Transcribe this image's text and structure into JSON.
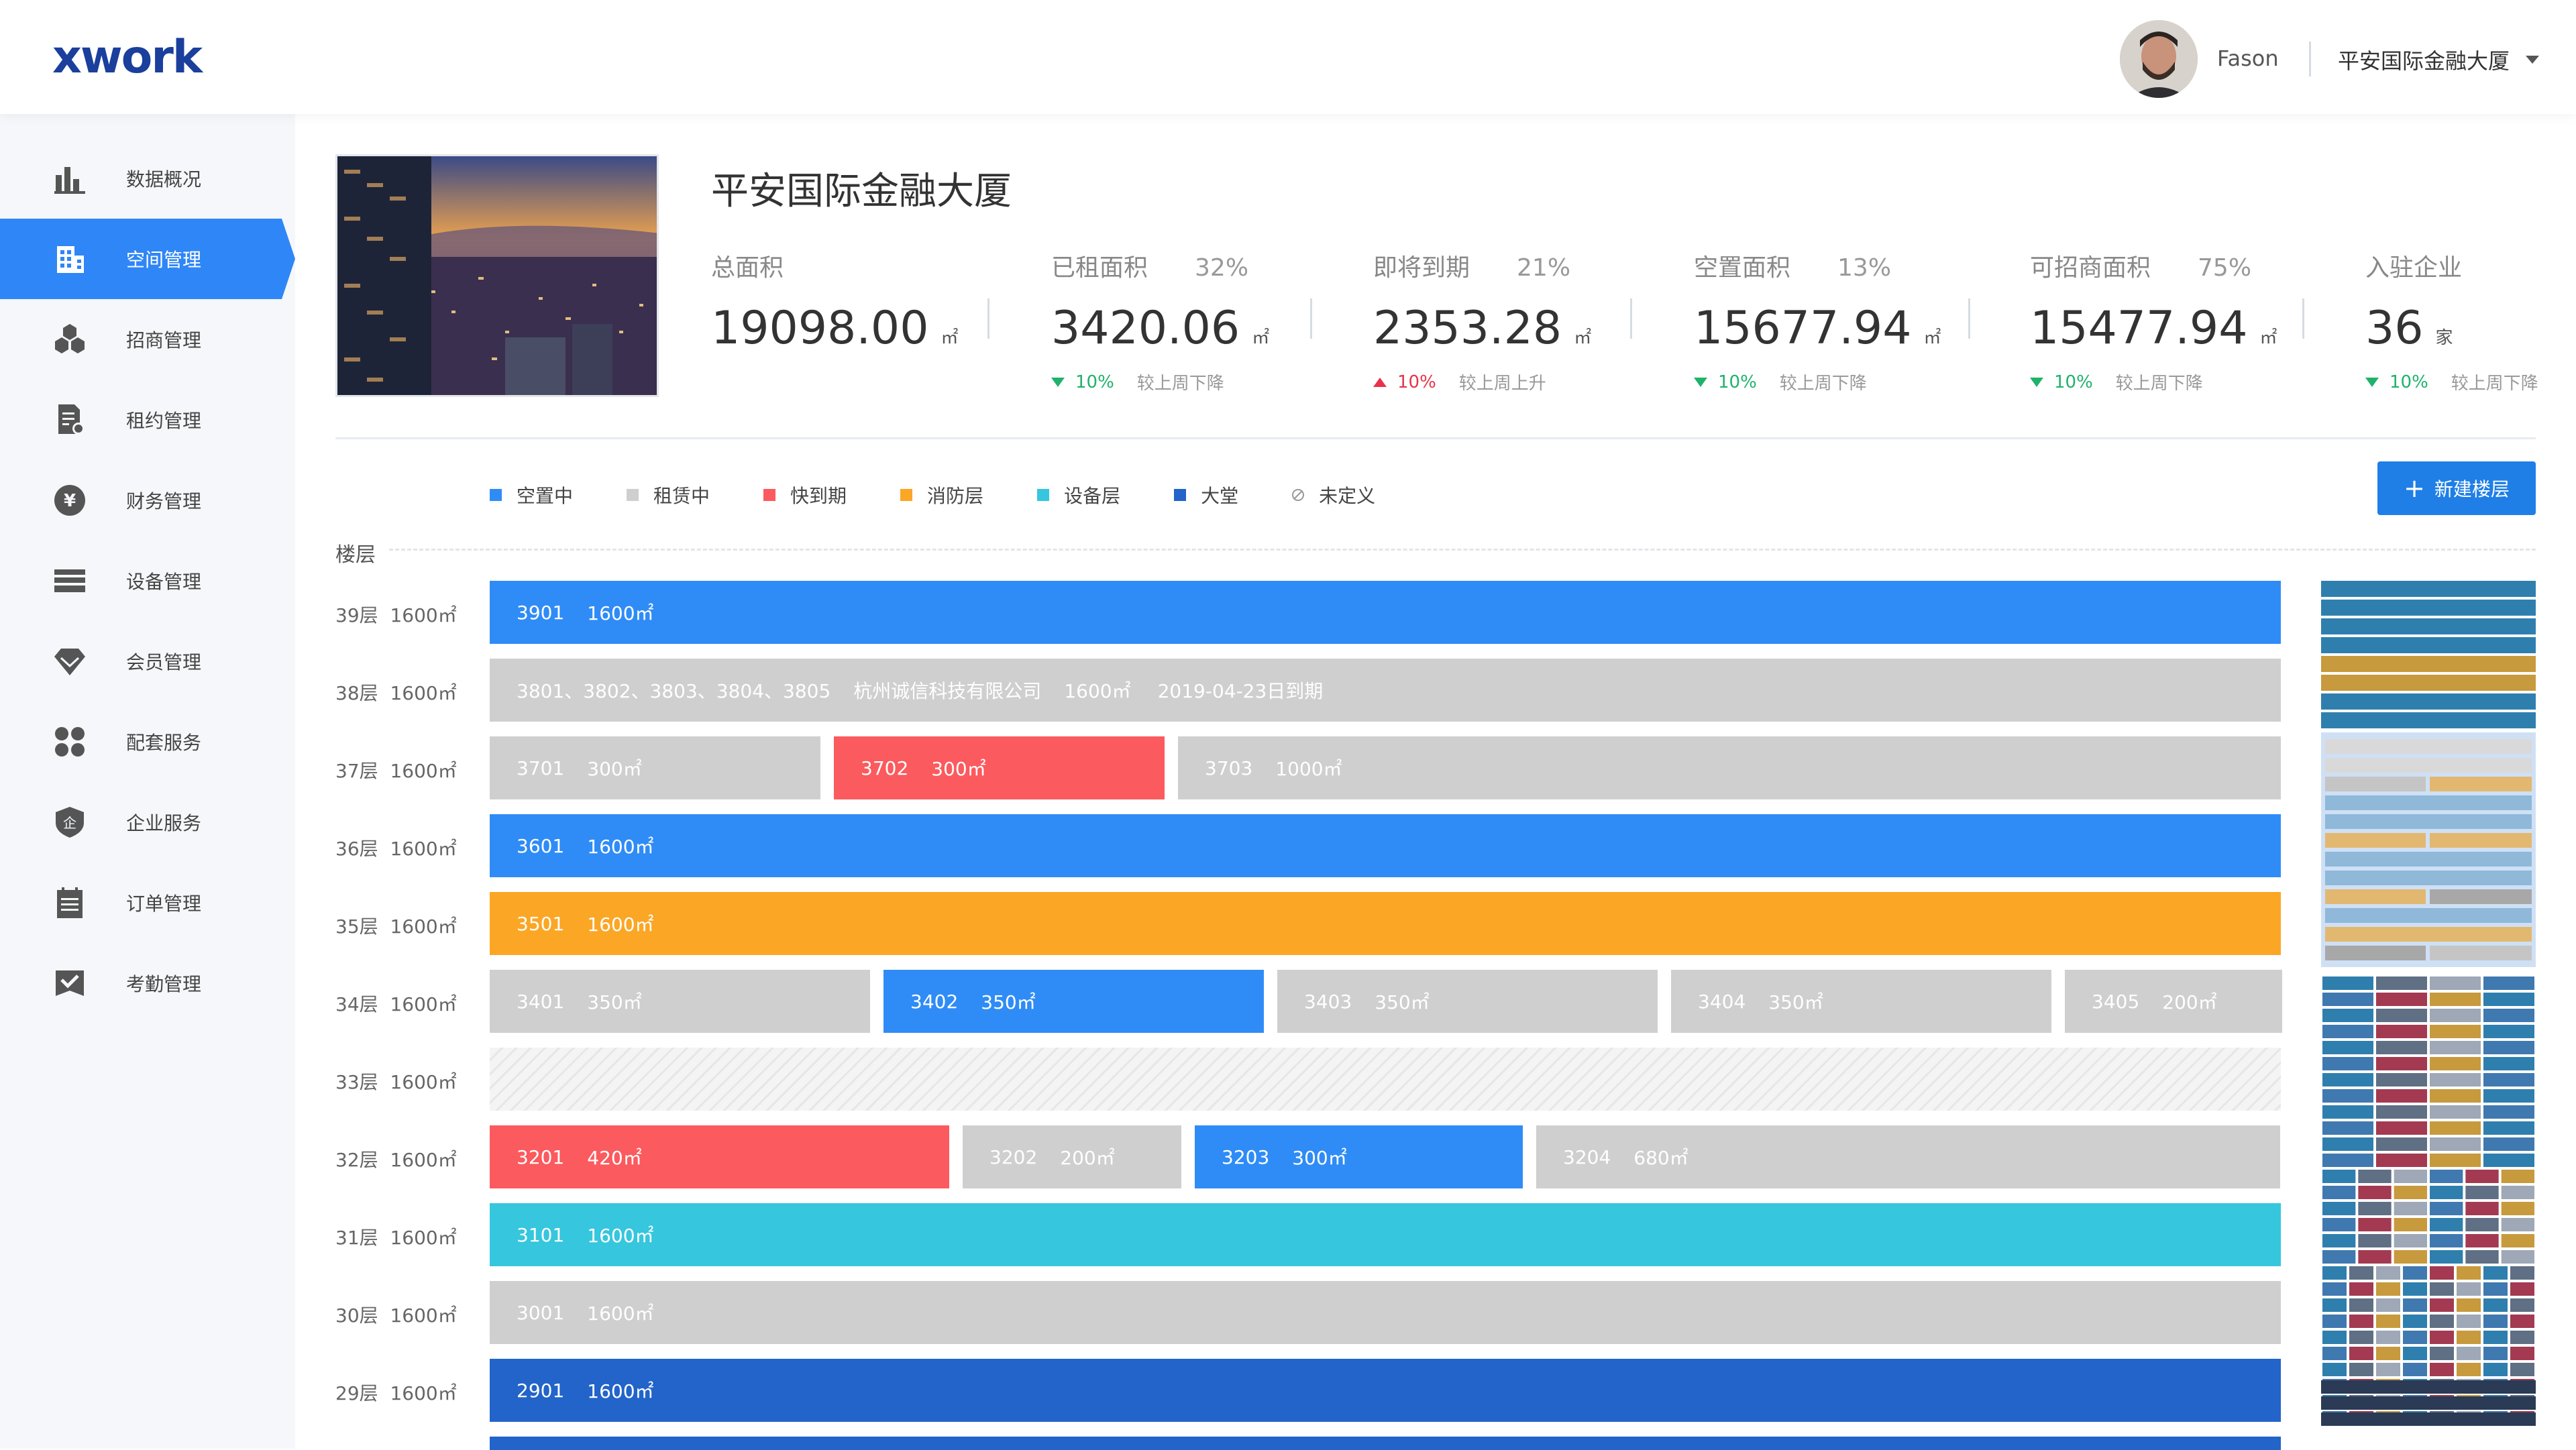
{
  "header": {
    "logo": "xwork",
    "user_name": "Fason",
    "building_select": "平安国际金融大厦"
  },
  "sidebar": {
    "items": [
      {
        "label": "数据概况",
        "icon": "bar-chart-icon",
        "active": false
      },
      {
        "label": "空间管理",
        "icon": "building-icon",
        "active": true
      },
      {
        "label": "招商管理",
        "icon": "hexagons-icon",
        "active": false
      },
      {
        "label": "租约管理",
        "icon": "contract-icon",
        "active": false
      },
      {
        "label": "财务管理",
        "icon": "yen-icon",
        "active": false
      },
      {
        "label": "设备管理",
        "icon": "device-icon",
        "active": false
      },
      {
        "label": "会员管理",
        "icon": "diamond-icon",
        "active": false
      },
      {
        "label": "配套服务",
        "icon": "grid-services-icon",
        "active": false
      },
      {
        "label": "企业服务",
        "icon": "shield-enterprise-icon",
        "active": false
      },
      {
        "label": "订单管理",
        "icon": "calendar-list-icon",
        "active": false
      },
      {
        "label": "考勤管理",
        "icon": "check-attendance-icon",
        "active": false
      }
    ]
  },
  "building": {
    "title": "平安国际金融大厦",
    "stats": [
      {
        "label": "总面积",
        "pct": "",
        "value": "19098.00",
        "unit": "㎡",
        "trend": "",
        "trend_desc": "",
        "dir": ""
      },
      {
        "label": "已租面积",
        "pct": "32%",
        "value": "3420.06",
        "unit": "㎡",
        "trend": "10%",
        "trend_desc": "较上周下降",
        "dir": "down"
      },
      {
        "label": "即将到期",
        "pct": "21%",
        "value": "2353.28",
        "unit": "㎡",
        "trend": "10%",
        "trend_desc": "较上周上升",
        "dir": "up"
      },
      {
        "label": "空置面积",
        "pct": "13%",
        "value": "15677.94",
        "unit": "㎡",
        "trend": "10%",
        "trend_desc": "较上周下降",
        "dir": "down"
      },
      {
        "label": "可招商面积",
        "pct": "75%",
        "value": "15477.94",
        "unit": "㎡",
        "trend": "10%",
        "trend_desc": "较上周下降",
        "dir": "down"
      },
      {
        "label": "入驻企业",
        "pct": "",
        "value": "36",
        "unit": "家",
        "trend": "10%",
        "trend_desc": "较上周下降",
        "dir": "down"
      }
    ]
  },
  "legend": [
    {
      "label": "空置中",
      "color": "#2f8cf6"
    },
    {
      "label": "租赁中",
      "color": "#cfcfcf"
    },
    {
      "label": "快到期",
      "color": "#fb5a5e"
    },
    {
      "label": "消防层",
      "color": "#fba625"
    },
    {
      "label": "设备层",
      "color": "#36c6de"
    },
    {
      "label": "大堂",
      "color": "#2264c9"
    },
    {
      "label": "未定义",
      "color": "#999999"
    }
  ],
  "new_floor_button": "新建楼层",
  "floor_header": "楼层",
  "floors": [
    {
      "label": "39层",
      "area": "1600㎡",
      "units": [
        {
          "num": "3901",
          "area": "1600㎡",
          "extra": "",
          "status": "vacant"
        }
      ]
    },
    {
      "label": "38层",
      "area": "1600㎡",
      "units": [
        {
          "num": "3801、3802、3803、3804、3805",
          "area": "1600㎡",
          "extra": "杭州诚信科技有限公司",
          "due": "2019-04-23日到期",
          "status": "rent"
        }
      ]
    },
    {
      "label": "37层",
      "area": "1600㎡",
      "units": [
        {
          "num": "3701",
          "area": "300㎡",
          "status": "rent"
        },
        {
          "num": "3702",
          "area": "300㎡",
          "status": "expire"
        },
        {
          "num": "3703",
          "area": "1000㎡",
          "status": "rent"
        }
      ]
    },
    {
      "label": "36层",
      "area": "1600㎡",
      "units": [
        {
          "num": "3601",
          "area": "1600㎡",
          "status": "vacant"
        }
      ]
    },
    {
      "label": "35层",
      "area": "1600㎡",
      "units": [
        {
          "num": "3501",
          "area": "1600㎡",
          "status": "fire"
        }
      ]
    },
    {
      "label": "34层",
      "area": "1600㎡",
      "units": [
        {
          "num": "3401",
          "area": "350㎡",
          "status": "rent"
        },
        {
          "num": "3402",
          "area": "350㎡",
          "status": "vacant"
        },
        {
          "num": "3403",
          "area": "350㎡",
          "status": "rent"
        },
        {
          "num": "3404",
          "area": "350㎡",
          "status": "rent"
        },
        {
          "num": "3405",
          "area": "200㎡",
          "status": "rent"
        }
      ]
    },
    {
      "label": "33层",
      "area": "1600㎡",
      "units": [
        {
          "num": "",
          "area": "",
          "status": "undef"
        }
      ]
    },
    {
      "label": "32层",
      "area": "1600㎡",
      "units": [
        {
          "num": "3201",
          "area": "420㎡",
          "status": "expire"
        },
        {
          "num": "3202",
          "area": "200㎡",
          "status": "rent"
        },
        {
          "num": "3203",
          "area": "300㎡",
          "status": "vacant"
        },
        {
          "num": "3204",
          "area": "680㎡",
          "status": "rent"
        }
      ]
    },
    {
      "label": "31层",
      "area": "1600㎡",
      "units": [
        {
          "num": "3101",
          "area": "1600㎡",
          "status": "equip"
        }
      ]
    },
    {
      "label": "30层",
      "area": "1600㎡",
      "units": [
        {
          "num": "3001",
          "area": "1600㎡",
          "status": "rent"
        }
      ]
    },
    {
      "label": "29层",
      "area": "1600㎡",
      "units": [
        {
          "num": "2901",
          "area": "1600㎡",
          "status": "lobby"
        }
      ]
    }
  ]
}
